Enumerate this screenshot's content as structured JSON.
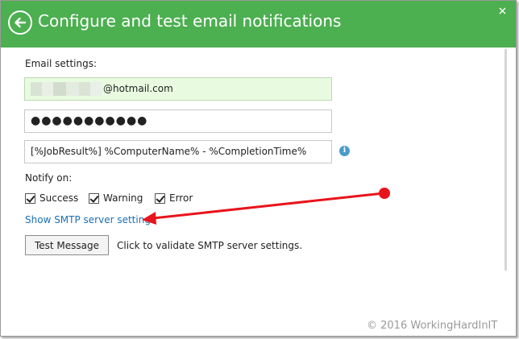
{
  "window": {
    "title": "Configure and test email notifications",
    "accent": "#4caf50",
    "back_icon": "back-arrow-icon",
    "close_icon": "close-icon"
  },
  "email_settings": {
    "section_label": "Email settings:",
    "to_address_suffix": "@hotmail.com",
    "password_mask": "●●●●●●●●●●●",
    "subject": "[%JobResult%] %ComputerName% - %CompletionTime%",
    "info_icon": "info-icon"
  },
  "notify": {
    "label": "Notify on:",
    "options": [
      {
        "label": "Success",
        "checked": true
      },
      {
        "label": "Warning",
        "checked": true
      },
      {
        "label": "Error",
        "checked": true
      }
    ]
  },
  "smtp_link": "Show SMTP server settings",
  "test": {
    "button_label": "Test Message",
    "hint": "Click to validate SMTP server settings."
  },
  "annotation": {
    "arrow_color": "#e8141c"
  },
  "watermark": "© 2016 WorkingHardInIT"
}
